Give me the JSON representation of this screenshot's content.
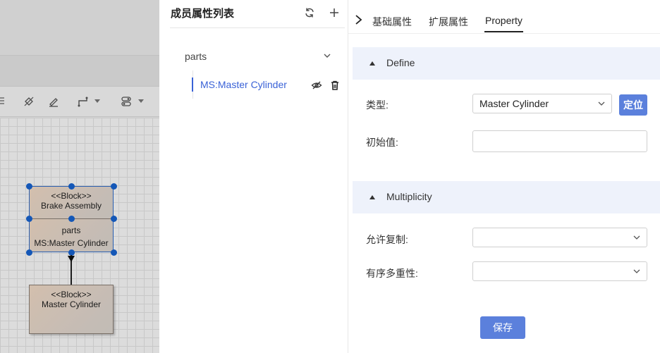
{
  "canvas": {
    "block_top": {
      "stereotype": "<<Block>>",
      "name": "Brake Assembly"
    },
    "block_parts": {
      "compartment": "parts",
      "entry": "MS:Master Cylinder"
    },
    "block_master": {
      "stereotype": "<<Block>>",
      "name": "Master Cylinder"
    },
    "toolbar_icons": [
      "paint-bucket-icon",
      "pen-icon",
      "connector-icon",
      "toggle-icon"
    ]
  },
  "member_panel": {
    "title": "成员属性列表",
    "refresh_icon": "refresh-icon",
    "add_icon": "plus-icon",
    "group_label": "parts",
    "item_label": "MS:Master Cylinder",
    "item_icons": [
      "eye-off-icon",
      "trash-icon"
    ]
  },
  "property_panel": {
    "tabs": [
      "基础属性",
      "扩展属性",
      "Property"
    ],
    "active_tab": "Property",
    "define": {
      "title": "Define",
      "type_label": "类型:",
      "type_value": "Master Cylinder",
      "locate_label": "定位",
      "initial_label": "初始值:",
      "initial_value": ""
    },
    "multiplicity": {
      "title": "Multiplicity",
      "allow_dup_label": "允许复制:",
      "allow_dup_value": "",
      "ordered_label": "有序多重性:",
      "ordered_value": ""
    },
    "save_label": "保存"
  },
  "colors": {
    "accent": "#5b80dc",
    "link": "#3a62d7",
    "section_bg": "#eef2fb",
    "selection": "#1763d1"
  }
}
